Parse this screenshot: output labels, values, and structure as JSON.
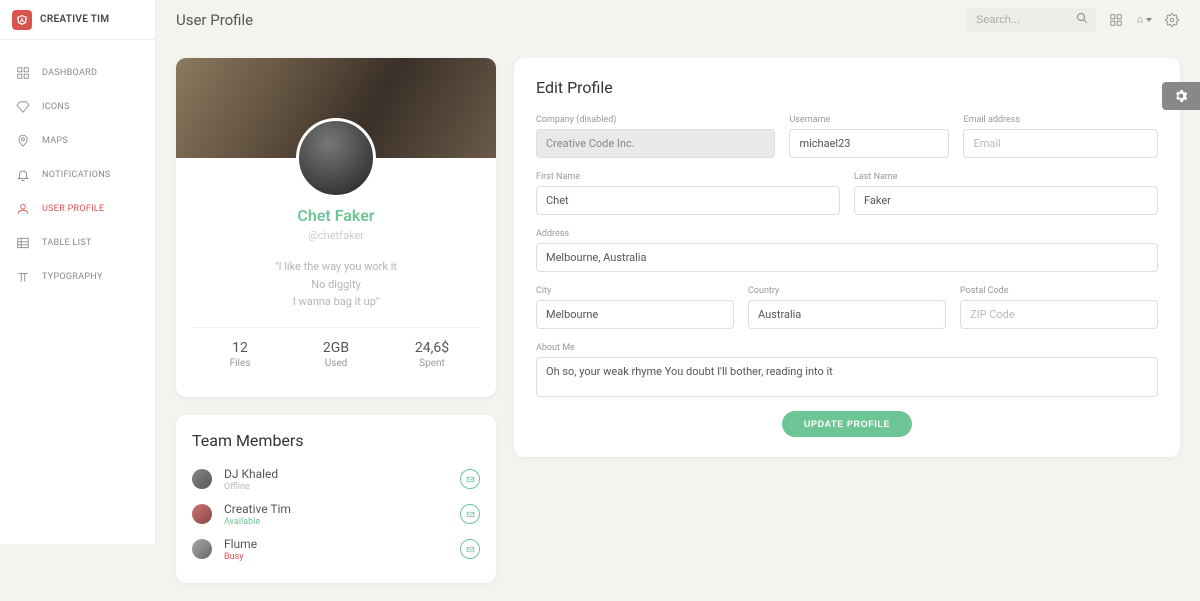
{
  "brand": "CREATIVE TIM",
  "page_title": "User Profile",
  "search": {
    "placeholder": "Search..."
  },
  "sidebar": {
    "items": [
      {
        "label": "DASHBOARD",
        "icon": "dashboard-icon"
      },
      {
        "label": "ICONS",
        "icon": "diamond-icon"
      },
      {
        "label": "MAPS",
        "icon": "map-pin-icon"
      },
      {
        "label": "NOTIFICATIONS",
        "icon": "bell-icon"
      },
      {
        "label": "USER PROFILE",
        "icon": "user-icon",
        "active": true
      },
      {
        "label": "TABLE LIST",
        "icon": "table-icon"
      },
      {
        "label": "TYPOGRAPHY",
        "icon": "typography-icon"
      }
    ]
  },
  "profile": {
    "name": "Chet Faker",
    "handle": "@chetfaker",
    "quote_lines": [
      "\"I like the way you work it",
      "No diggity",
      "I wanna bag it up\""
    ],
    "stats": [
      {
        "value": "12",
        "label": "Files"
      },
      {
        "value": "2GB",
        "label": "Used"
      },
      {
        "value": "24,6$",
        "label": "Spent"
      }
    ]
  },
  "team": {
    "title": "Team Members",
    "members": [
      {
        "name": "DJ Khaled",
        "status": "Offline",
        "status_class": "status-offline"
      },
      {
        "name": "Creative Tim",
        "status": "Available",
        "status_class": "status-available"
      },
      {
        "name": "Flume",
        "status": "Busy",
        "status_class": "status-busy"
      }
    ]
  },
  "form": {
    "title": "Edit Profile",
    "company": {
      "label": "Company (disabled)",
      "value": "Creative Code Inc."
    },
    "username": {
      "label": "Username",
      "value": "michael23"
    },
    "email": {
      "label": "Email address",
      "placeholder": "Email",
      "value": ""
    },
    "first_name": {
      "label": "First Name",
      "value": "Chet"
    },
    "last_name": {
      "label": "Last Name",
      "value": "Faker"
    },
    "address": {
      "label": "Address",
      "value": "Melbourne, Australia"
    },
    "city": {
      "label": "City",
      "value": "Melbourne"
    },
    "country": {
      "label": "Country",
      "value": "Australia"
    },
    "postal": {
      "label": "Postal Code",
      "placeholder": "ZIP Code",
      "value": ""
    },
    "about": {
      "label": "About Me",
      "value": "Oh so, your weak rhyme You doubt I'll bother, reading into it"
    },
    "submit": "UPDATE PROFILE"
  }
}
